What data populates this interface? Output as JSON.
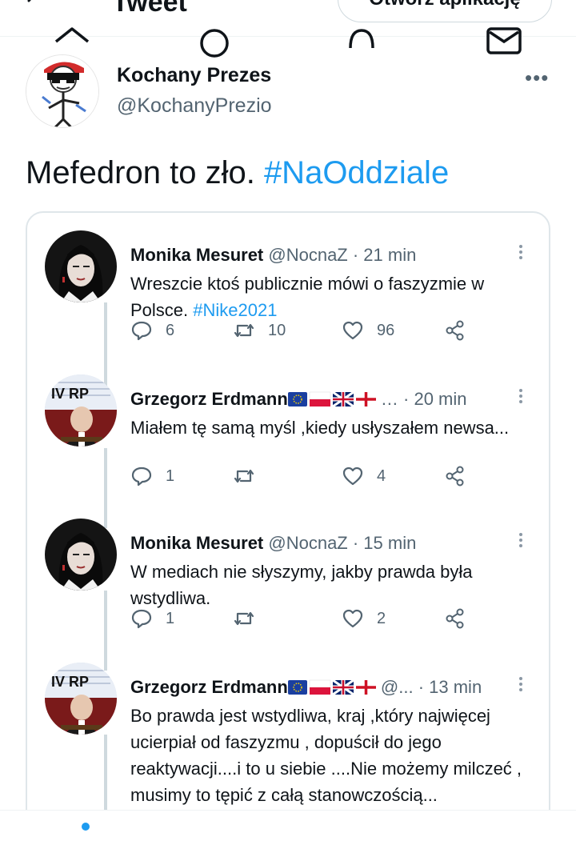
{
  "header": {
    "title": "Tweet",
    "open_app": "Otwórz aplikację"
  },
  "tweet": {
    "author_name": "Kochany Prezes",
    "author_handle": "@KochanyPrezio",
    "text": "Mefedron to zło. ",
    "hashtag": "#NaOddziale"
  },
  "replies": [
    {
      "name": "Monika Mesuret",
      "meta": " @NocnaZ · 21 min",
      "text": "Wreszcie ktoś publicznie mówi o faszyzmie w Polsce. ",
      "hashtag": "#Nike2021",
      "replies": "6",
      "retweets": "10",
      "likes": "96"
    },
    {
      "name": "Grzegorz Erdmann",
      "meta": " … · 20 min",
      "text": "Miałem tę samą myśl ,kiedy usłyszałem newsa...",
      "hashtag": "",
      "replies": "1",
      "retweets": "",
      "likes": "4"
    },
    {
      "name": "Monika Mesuret",
      "meta": " @NocnaZ · 15 min",
      "text": "W mediach nie słyszymy, jakby prawda była wstydliwa.",
      "hashtag": "",
      "replies": "1",
      "retweets": "",
      "likes": "2"
    },
    {
      "name": "Grzegorz Erdmann",
      "meta": " @... · 13 min",
      "text": "Bo prawda jest wstydliwa, kraj ,który najwięcej ucierpiał od faszyzmu , dopuścił do jego reaktywacji....i to u siebie ....Nie możemy milczeć , musimy to tępić z całą stanowczością...",
      "hashtag": "",
      "replies": "",
      "retweets": "",
      "likes": ""
    }
  ],
  "avatar_labels": {
    "ivrp": "IV RP"
  },
  "colors": {
    "accent": "#1d9bf0",
    "muted": "#536471",
    "border": "#cfd9de"
  },
  "icons": [
    "back-arrow-icon",
    "more-icon",
    "reply-icon",
    "retweet-icon",
    "like-icon",
    "share-icon",
    "home-icon",
    "search-icon",
    "notifications-icon",
    "messages-icon",
    "eu-flag-icon",
    "poland-flag-icon",
    "uk-flag-icon",
    "england-flag-icon"
  ]
}
